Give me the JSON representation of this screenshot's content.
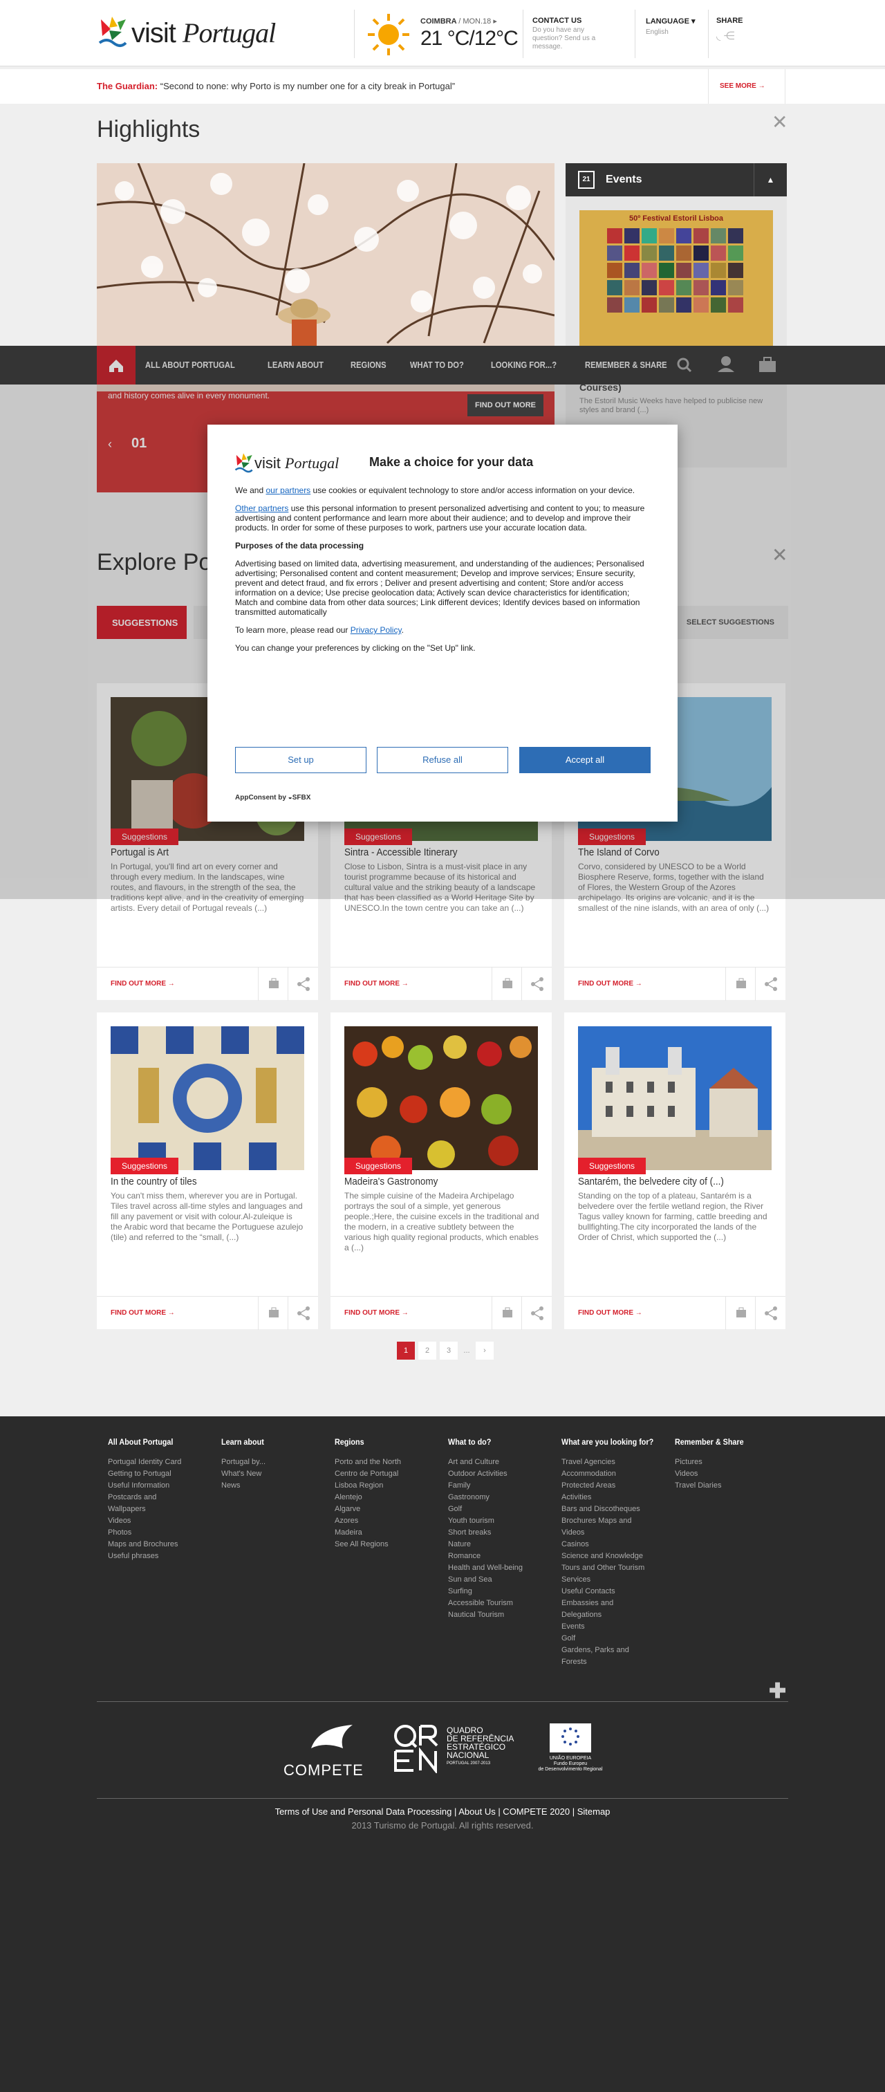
{
  "header": {
    "logo_text_a": "visit",
    "logo_text_b": "Portugal",
    "weather": {
      "city": "COIMBRA",
      "date": "/ MON.18",
      "temp": "21 °C/12°C"
    },
    "contact": {
      "title": "CONTACT US",
      "text": "Do you have any question? Send us a message."
    },
    "language": {
      "title": "LANGUAGE",
      "value": "English"
    },
    "share": {
      "title": "SHARE"
    }
  },
  "ticker": {
    "source": "The Guardian:",
    "headline": " “Second to none: why Porto is my number one for a city break in Portugal”",
    "more": "SEE MORE"
  },
  "highlights": {
    "title": "Highlights",
    "slide_text": "and history comes alive in every monument.",
    "find_more": "FIND OUT MORE",
    "slide_num": "01",
    "events_title": "Events",
    "event_day": "21",
    "poster_title": "50º Festival Estoril Lisboa",
    "event_heading": "Courses)",
    "event_text": "The Estoril Music Weeks have helped to publicise new styles and brand (...)"
  },
  "nav": {
    "items": [
      "ALL ABOUT PORTUGAL",
      "LEARN ABOUT",
      "REGIONS",
      "WHAT TO DO?",
      "LOOKING FOR...?",
      "REMEMBER & SHARE"
    ]
  },
  "explore": {
    "title": "Explore Portugal",
    "filter": "SUGGESTIONS",
    "select": "SELECT SUGGESTIONS"
  },
  "cards": [
    {
      "tag": "Suggestions",
      "title": "Portugal is Art",
      "desc": "In Portugal, you'll find art on every corner and through every medium. In the landscapes, wine routes, and flavours, in the strength of the sea, the traditions kept alive, and in the creativity of emerging artists. Every detail of Portugal reveals (...)",
      "more": "FIND OUT MORE"
    },
    {
      "tag": "Suggestions",
      "title": "Sintra - Accessible Itinerary",
      "desc": "Close to Lisbon, Sintra is a must-visit place in any tourist programme because of its historical and cultural value and the striking beauty of a landscape that has been classified as a World Heritage Site by UNESCO.In the town centre you can take an (...)",
      "more": "FIND OUT MORE"
    },
    {
      "tag": "Suggestions",
      "title": "The Island of Corvo",
      "desc": "Corvo, considered by UNESCO to be a World Biosphere Reserve, forms, together with the island of Flores, the Western Group of the Azores archipelago. Its origins are volcanic, and it is the smallest of the nine islands, with an area of only (...)",
      "more": "FIND OUT MORE"
    },
    {
      "tag": "Suggestions",
      "title": "In the country of tiles",
      "desc": "You can't miss them, wherever you are in Portugal. Tiles travel across all-time styles and languages and fill any pavement or visit with colour.Al-zuleique is the Arabic word that became the Portuguese azulejo (tile) and referred to the “small, (...)",
      "more": "FIND OUT MORE"
    },
    {
      "tag": "Suggestions",
      "title": "Madeira's Gastronomy",
      "desc": "The simple cuisine of the Madeira Archipelago portrays the soul of a simple, yet generous people.;Here, the cuisine excels in the traditional and the modern, in a creative subtlety between the various high quality regional products, which enables a (...)",
      "more": "FIND OUT MORE"
    },
    {
      "tag": "Suggestions",
      "title": "Santarém, the belvedere city of (...)",
      "desc": "Standing on the top of a plateau, Santarém is a belvedere over the fertile wetland region, the River Tagus valley known for farming, cattle breeding and bullfighting.The city incorporated the lands of the Order of Christ, which supported the (...)",
      "more": "FIND OUT MORE"
    }
  ],
  "pagination": [
    "1",
    "2",
    "3",
    "...",
    "›"
  ],
  "footer": {
    "cols": [
      {
        "title": "All About Portugal",
        "items": [
          "Portugal Identity Card",
          "Getting to Portugal",
          "Useful Information",
          "Postcards and Wallpapers",
          "Videos",
          "Photos",
          "Maps and Brochures",
          "Useful phrases"
        ]
      },
      {
        "title": "Learn about",
        "items": [
          "Portugal by...",
          "What's New",
          "News"
        ]
      },
      {
        "title": "Regions",
        "items": [
          "Porto and the North",
          "Centro de Portugal",
          "Lisboa Region",
          "Alentejo",
          "Algarve",
          "Azores",
          "Madeira",
          "See All Regions"
        ]
      },
      {
        "title": "What to do?",
        "items": [
          "Art and Culture",
          "Outdoor Activities",
          "Family",
          "Gastronomy",
          "Golf",
          "Youth tourism",
          "Short breaks",
          "Nature",
          "Romance",
          "Health and Well-being",
          "Sun and Sea",
          "Surfing",
          "Accessible Tourism",
          "Nautical Tourism"
        ]
      },
      {
        "title": "What are you looking for?",
        "items": [
          "Travel Agencies",
          "Accommodation",
          "Protected Areas",
          "Activities",
          "Bars and Discotheques",
          "Brochures Maps and Videos",
          "Casinos",
          "Science and Knowledge",
          "Tours and Other Tourism Services",
          "Useful Contacts",
          "Embassies and Delegations",
          "Events",
          "Golf",
          "Gardens, Parks and Forests"
        ]
      },
      {
        "title": "Remember & Share",
        "items": [
          "Pictures",
          "Videos",
          "Travel Diaries"
        ]
      }
    ],
    "compete": "COMPETE",
    "qren_lines": [
      "QUADRO",
      "DE REFERÊNCIA",
      "ESTRATÉGICO",
      "NACIONAL",
      "PORTUGAL 2007-2013"
    ],
    "eu_lines": [
      "UNIÃO EUROPEIA",
      "Fundo Europeu",
      "de Desenvolvimento Regional"
    ],
    "links": "Terms of Use and Personal Data Processing | About Us | COMPETE 2020 | Sitemap",
    "copyright": "2013 Turismo de Portugal. All rights reserved."
  },
  "consent": {
    "title": "Make a choice for your data",
    "p1_a": "We and ",
    "p1_link": "our partners",
    "p1_b": " use cookies or equivalent technology to store and/or access information on your device.",
    "p2_link": "Other partners",
    "p2_b": " use this personal information to present personalized advertising and content to you; to measure advertising and content performance and learn more about their audience; and to develop and improve their products. In order for some of these purposes to work, partners use your accurate location data.",
    "purposes_title": "Purposes of the data processing",
    "purposes": "Advertising based on limited data, advertising measurement, and understanding of the audiences; Personalised advertising; Personalised content and content measurement; Develop and improve services; Ensure security, prevent and detect fraud, and fix errors ; Deliver and present advertising and content; Store and/or access information on a device; Use precise geolocation data; Actively scan device characteristics for identification; Match and combine data from other data sources; Link different devices; Identify devices based on information transmitted automatically",
    "learn_a": "To learn more, please read our ",
    "learn_link": "Privacy Policy",
    "learn_b": ".",
    "change": "You can change your preferences by clicking on the \"Set Up\" link.",
    "btn_setup": "Set up",
    "btn_refuse": "Refuse all",
    "btn_accept": "Accept all",
    "appconsent": "AppConsent by ",
    "sfbx": "SFBX"
  },
  "colors": {
    "brand_red": "#d4202c",
    "nav_bg": "#3b3b3b",
    "footer_bg": "#2b2b2b",
    "consent_blue": "#2d6db5"
  }
}
